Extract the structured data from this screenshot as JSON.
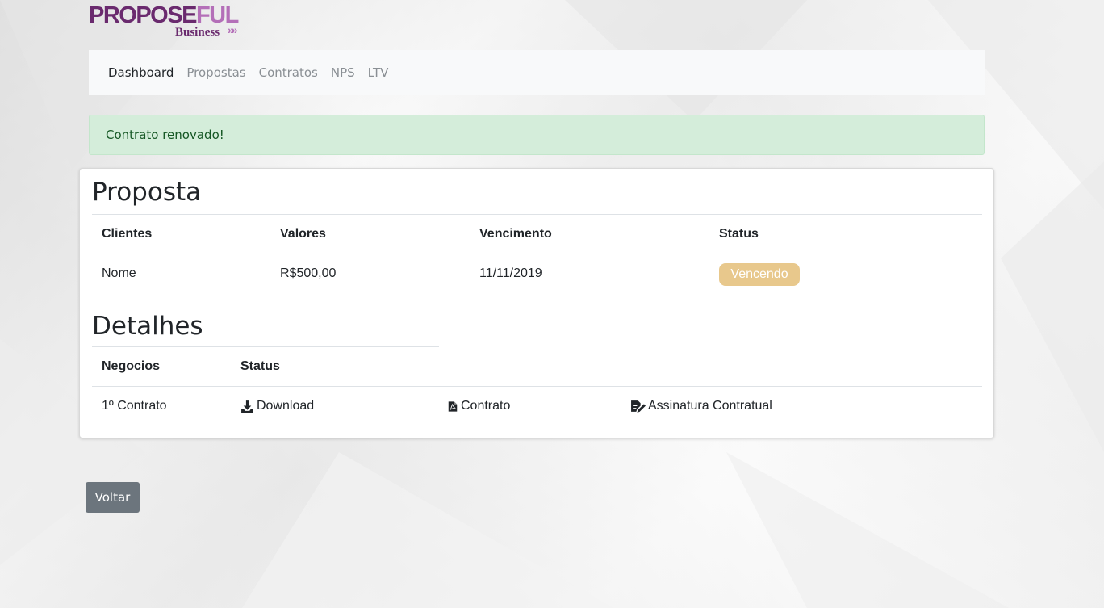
{
  "brand": {
    "logo_main": "PROPOSE",
    "logo_accent": "FUL",
    "logo_sub": "Business",
    "logo_arrows": "»»",
    "colors": {
      "primary": "#6a2a6e",
      "accent": "#b46fb8"
    }
  },
  "nav": {
    "items": [
      {
        "label": "Dashboard",
        "active": true
      },
      {
        "label": "Propostas",
        "active": false
      },
      {
        "label": "Contratos",
        "active": false
      },
      {
        "label": "NPS",
        "active": false
      },
      {
        "label": "LTV",
        "active": false
      }
    ]
  },
  "alert": {
    "message": "Contrato renovado!",
    "color": "#d4edda"
  },
  "proposta": {
    "title": "Proposta",
    "columns": [
      "Clientes",
      "Valores",
      "Vencimento",
      "Status"
    ],
    "row": {
      "cliente": "Nome",
      "valor": "R$500,00",
      "vencimento": "11/11/2019",
      "status": "Vencendo",
      "status_color": "#e8c88c"
    }
  },
  "detalhes": {
    "title": "Detalhes",
    "columns": [
      "Negocios",
      "Status"
    ],
    "row": {
      "negocio": "1º Contrato",
      "download": {
        "label": "Download",
        "icon": "download-icon"
      },
      "contrato": {
        "label": "Contrato",
        "icon": "pdf-file-icon"
      },
      "assinatura": {
        "label": "Assinatura Contratual",
        "icon": "signature-icon"
      }
    }
  },
  "footer": {
    "back_label": "Voltar"
  }
}
